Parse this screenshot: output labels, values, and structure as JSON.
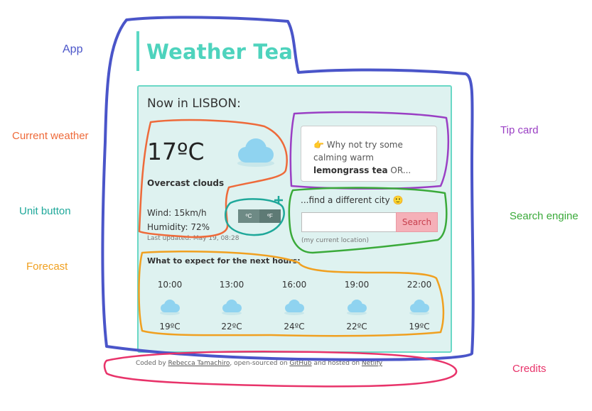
{
  "annotations": {
    "app": "App",
    "current_weather": "Current weather",
    "unit_button": "Unit button",
    "forecast": "Forecast",
    "tip_card": "Tip card",
    "search_engine": "Search engine",
    "credits": "Credits"
  },
  "app": {
    "title": "Weather Tea"
  },
  "current": {
    "heading": "Now in LISBON:",
    "temperature": "17ºC",
    "description": "Overcast clouds",
    "wind": "Wind: 15km/h",
    "humidity": "Humidity: 72%",
    "last_updated": "Last updated: May 19, 08:28",
    "icon": "cloud-icon"
  },
  "units": {
    "celsius": "ºC",
    "fahrenheit": "ºF"
  },
  "tip": {
    "emoji": "👉",
    "text_before": "Why not try some calming warm",
    "highlight": "lemongrass tea",
    "text_after": "OR..."
  },
  "search": {
    "label": "...find a different city",
    "emoji": "🙂",
    "input_value": "",
    "button_label": "Search",
    "current_location_label": "(my current location)"
  },
  "forecast": {
    "title": "What to expect for the next hours:",
    "items": [
      {
        "time": "10:00",
        "temp": "19ºC",
        "icon": "cloud-icon"
      },
      {
        "time": "13:00",
        "temp": "22ºC",
        "icon": "cloud-icon"
      },
      {
        "time": "16:00",
        "temp": "24ºC",
        "icon": "cloud-icon"
      },
      {
        "time": "19:00",
        "temp": "22ºC",
        "icon": "cloud-icon"
      },
      {
        "time": "22:00",
        "temp": "19ºC",
        "icon": "cloud-icon"
      }
    ]
  },
  "credits": {
    "prefix": "Coded by",
    "author": "Rebecca Tamachiro",
    "middle": ", open-sourced on",
    "github": "GitHub",
    "hosted": "and hosted on",
    "netlify": "Netlify"
  },
  "colors": {
    "accent": "#4ed3bd",
    "card_bg": "#def2f0",
    "app_outline": "#4a55c9",
    "current_outline": "#ee6a3a",
    "unit_outline": "#1fa89a",
    "forecast_outline": "#f0a020",
    "tip_outline": "#9a3fc4",
    "search_outline": "#3aaa3a",
    "credits_outline": "#e8336a"
  }
}
